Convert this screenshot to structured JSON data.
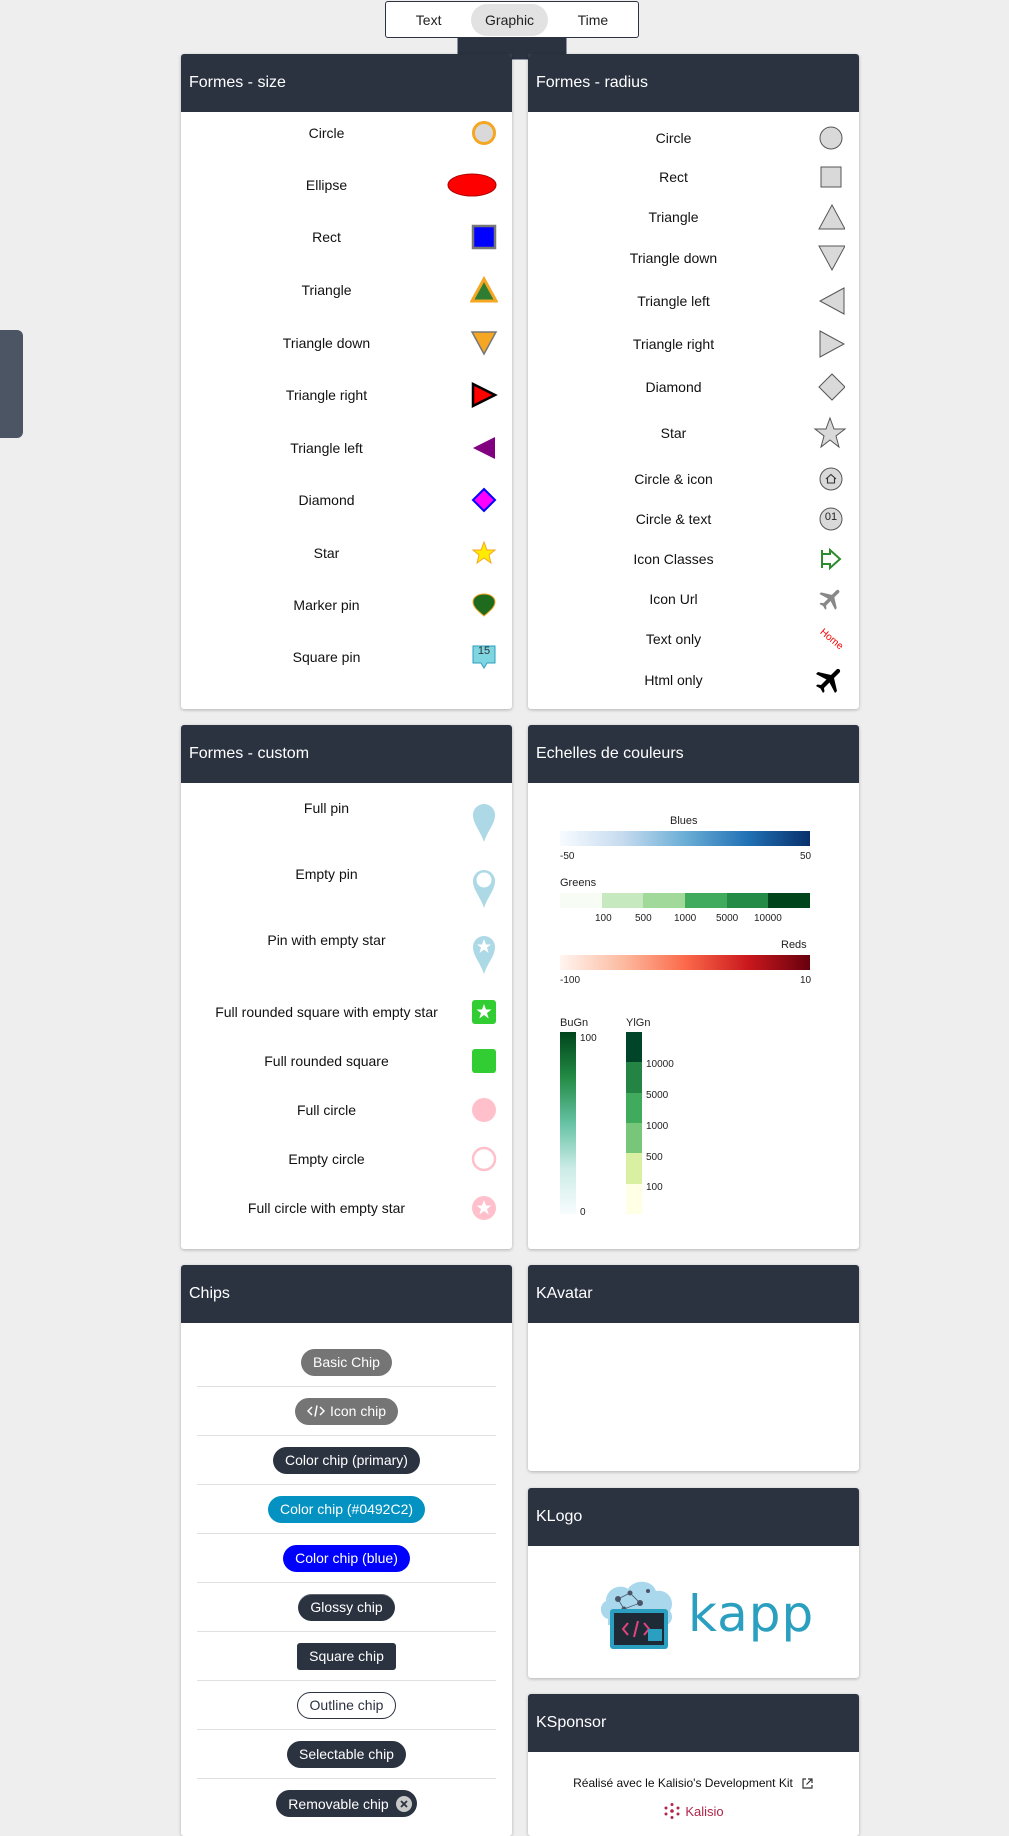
{
  "tabs": [
    {
      "label": "Text",
      "active": false
    },
    {
      "label": "Graphic",
      "active": true
    },
    {
      "label": "Time",
      "active": false
    }
  ],
  "size_card": {
    "title": "Formes - size",
    "items": [
      "Circle",
      "Ellipse",
      "Rect",
      "Triangle",
      "Triangle down",
      "Triangle right",
      "Triangle left",
      "Diamond",
      "Star",
      "Marker pin",
      "Square pin"
    ],
    "square_pin_text": "15"
  },
  "radius_card": {
    "title": "Formes - radius",
    "items": [
      "Circle",
      "Rect",
      "Triangle",
      "Triangle down",
      "Triangle left",
      "Triangle right",
      "Diamond",
      "Star",
      "Circle & icon",
      "Circle & text",
      "Icon Classes",
      "Icon Url",
      "Text only",
      "Html only"
    ],
    "circle_text": "01",
    "text_only_text": "Home"
  },
  "custom_card": {
    "title": "Formes - custom",
    "items": [
      "Full pin",
      "Empty pin",
      "Pin with empty star",
      "Full rounded square with empty star",
      "Full rounded square",
      "Full circle",
      "Empty circle",
      "Full circle with empty star"
    ]
  },
  "scales_card": {
    "title": "Echelles de couleurs",
    "blues": {
      "name": "Blues",
      "min": "-50",
      "max": "50"
    },
    "greens": {
      "name": "Greens",
      "ticks": [
        "100",
        "500",
        "1000",
        "5000",
        "10000"
      ]
    },
    "reds": {
      "name": "Reds",
      "min": "-100",
      "max": "10"
    },
    "bugn": {
      "name": "BuGn",
      "max": "100",
      "min": "0"
    },
    "ylgn": {
      "name": "YlGn",
      "ticks": [
        "10000",
        "5000",
        "1000",
        "500",
        "100"
      ]
    }
  },
  "chips_card": {
    "title": "Chips",
    "chips": [
      {
        "label": "Basic Chip",
        "bg": "#757575"
      },
      {
        "label": "Icon chip",
        "bg": "#757575"
      },
      {
        "label": "Color chip (primary)",
        "bg": "#2b3240"
      },
      {
        "label": "Color chip (#0492C2)",
        "bg": "#0492C2"
      },
      {
        "label": "Color chip (blue)",
        "bg": "#0000ff"
      },
      {
        "label": "Glossy chip",
        "bg": "#2b3240"
      },
      {
        "label": "Square chip",
        "bg": "#2b3240"
      },
      {
        "label": "Outline chip",
        "bg": "#ffffff"
      },
      {
        "label": "Selectable chip",
        "bg": "#2b3240"
      },
      {
        "label": "Removable chip",
        "bg": "#2b3240"
      }
    ]
  },
  "avatar_card": {
    "title": "KAvatar"
  },
  "logo_card": {
    "title": "KLogo",
    "logo_text": "kapp"
  },
  "sponsor_card": {
    "title": "KSponsor",
    "text": "Réalisé avec le Kalisio's Development Kit",
    "brand": "Kalisio"
  },
  "colors": {
    "header": "#2b3240",
    "accent_teal": "#2a9fc0",
    "kalisio_red": "#b0264a"
  }
}
